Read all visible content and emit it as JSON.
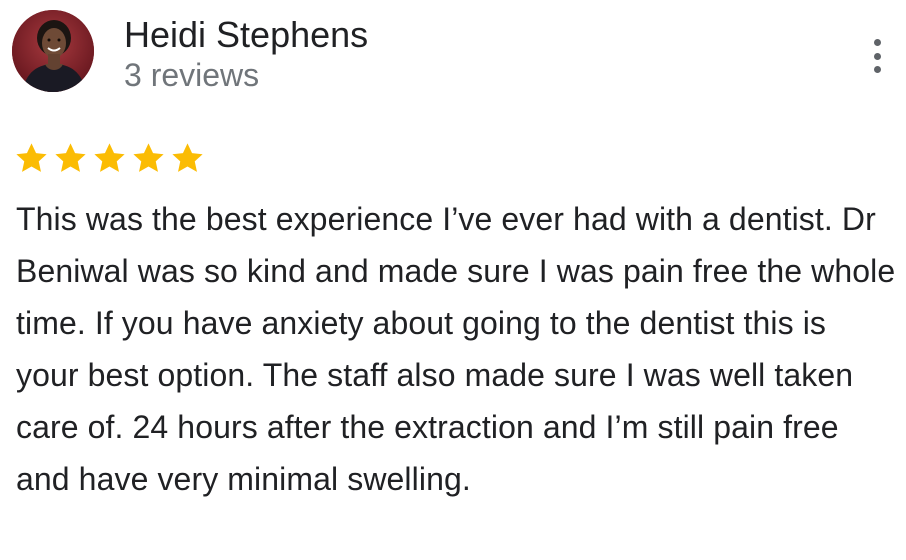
{
  "reviewer": {
    "name": "Heidi Stephens",
    "reviews_count": "3 reviews",
    "avatar_icon": "reviewer-photo"
  },
  "rating": {
    "stars": 5,
    "max": 5,
    "star_color": "#fbbc04"
  },
  "menu": {
    "icon": "more-vert-icon"
  },
  "review": {
    "text": "This was the best experience I’ve ever had with a dentist. Dr Beniwal was so kind and made sure I was pain free the whole time. If you have anxiety about going to the dentist this is your best option. The staff also made sure I was well taken care of. 24 hours after the extraction and I’m still pain free and have very minimal swelling."
  },
  "colors": {
    "text_primary": "#202124",
    "text_secondary": "#70757a",
    "icon_gray": "#5f6368"
  }
}
